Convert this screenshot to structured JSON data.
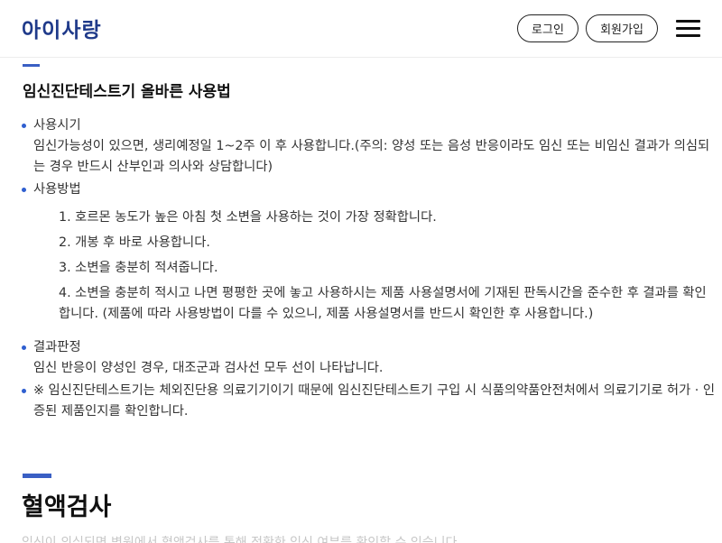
{
  "header": {
    "logo": "아이사랑",
    "login_label": "로그인",
    "signup_label": "회원가입",
    "menu_icon": "hamburger-menu-icon"
  },
  "section": {
    "title": "임신진단테스트기 올바른 사용법",
    "usage_time_heading": "사용시기",
    "usage_time_text": "임신가능성이 있으면, 생리예정일 1~2주 이 후 사용합니다.(주의: 양성 또는 음성 반응이라도 임신 또는 비임신 결과가 의심되는 경우 반드시 산부인과 의사와 상담합니다)",
    "usage_method_heading": "사용방법",
    "steps": [
      "1. 호르몬 농도가 높은 아침 첫 소변을 사용하는 것이 가장 정확합니다.",
      "2. 개봉 후 바로 사용합니다.",
      "3. 소변을 충분히 적셔줍니다.",
      "4. 소변을 충분히 적시고 나면 평평한 곳에 놓고 사용하시는 제품 사용설명서에 기재된 판독시간을 준수한 후 결과를 확인합니다. (제품에 따라 사용방법이 다를 수 있으니, 제품 사용설명서를 반드시 확인한 후 사용합니다.)"
    ],
    "result_heading": "결과판정",
    "result_text": "임신 반응이 양성인 경우, 대조군과 검사선 모두 선이 나타납니다.",
    "note_text": "※ 임신진단테스트기는 체외진단용 의료기기이기 때문에 임신진단테스트기 구입 시 식품의약품안전처에서 의료기기로 허가 · 인증된 제품인지를 확인합니다."
  },
  "next_section": {
    "title": "혈액검사",
    "cutoff_text": "임신이 의심되면 병원에서 혈액검사를 통해 정확한 임신 여부를 확인할 수 있습니다."
  },
  "colors": {
    "accent": "#3a5fc4",
    "logo": "#1f3a8a",
    "bullet": "#2f5fd0"
  }
}
